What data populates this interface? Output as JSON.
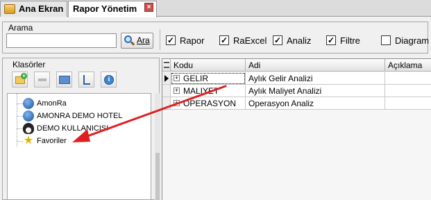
{
  "tabs": [
    {
      "label": "Ana Ekran",
      "active": false
    },
    {
      "label": "Rapor Yönetim",
      "active": true
    }
  ],
  "tab_close_icon": "close-icon",
  "search": {
    "group_title": "Arama",
    "input_value": "",
    "button_label": "Ara",
    "button_icon": "search-icon"
  },
  "filters": [
    {
      "label": "Rapor",
      "checked": true
    },
    {
      "label": "RaExcel",
      "checked": true
    },
    {
      "label": "Analiz",
      "checked": true
    },
    {
      "label": "Filtre",
      "checked": true
    },
    {
      "label": "Diagram",
      "checked": false
    }
  ],
  "folders": {
    "title": "Klasörler",
    "toolbar": [
      "add-folder-icon",
      "remove-icon",
      "folder-icon",
      "tree-icon",
      "info-icon"
    ],
    "items": [
      {
        "label": "AmonRa",
        "icon": "globe-icon"
      },
      {
        "label": "AMONRA DEMO HOTEL",
        "icon": "globe-icon"
      },
      {
        "label": "DEMO KULLANICISI",
        "icon": "user-icon"
      },
      {
        "label": "Favoriler",
        "icon": "star-icon"
      }
    ]
  },
  "grid": {
    "columns": [
      "Kodu",
      "Adi",
      "Açıklama"
    ],
    "rows": [
      {
        "kodu": "GELIR",
        "adi": "Aylık Gelir Analizi",
        "aciklama": "",
        "current": true
      },
      {
        "kodu": "MALIYET",
        "adi": "Aylık Maliyet Analizi",
        "aciklama": "",
        "current": false
      },
      {
        "kodu": "OPERASYON",
        "adi": "Operasyon Analiz",
        "aciklama": "",
        "current": false
      }
    ]
  },
  "colors": {
    "annotation_arrow": "#e02020",
    "active_tab": "#ffffff",
    "tab_close": "#c9504d"
  }
}
